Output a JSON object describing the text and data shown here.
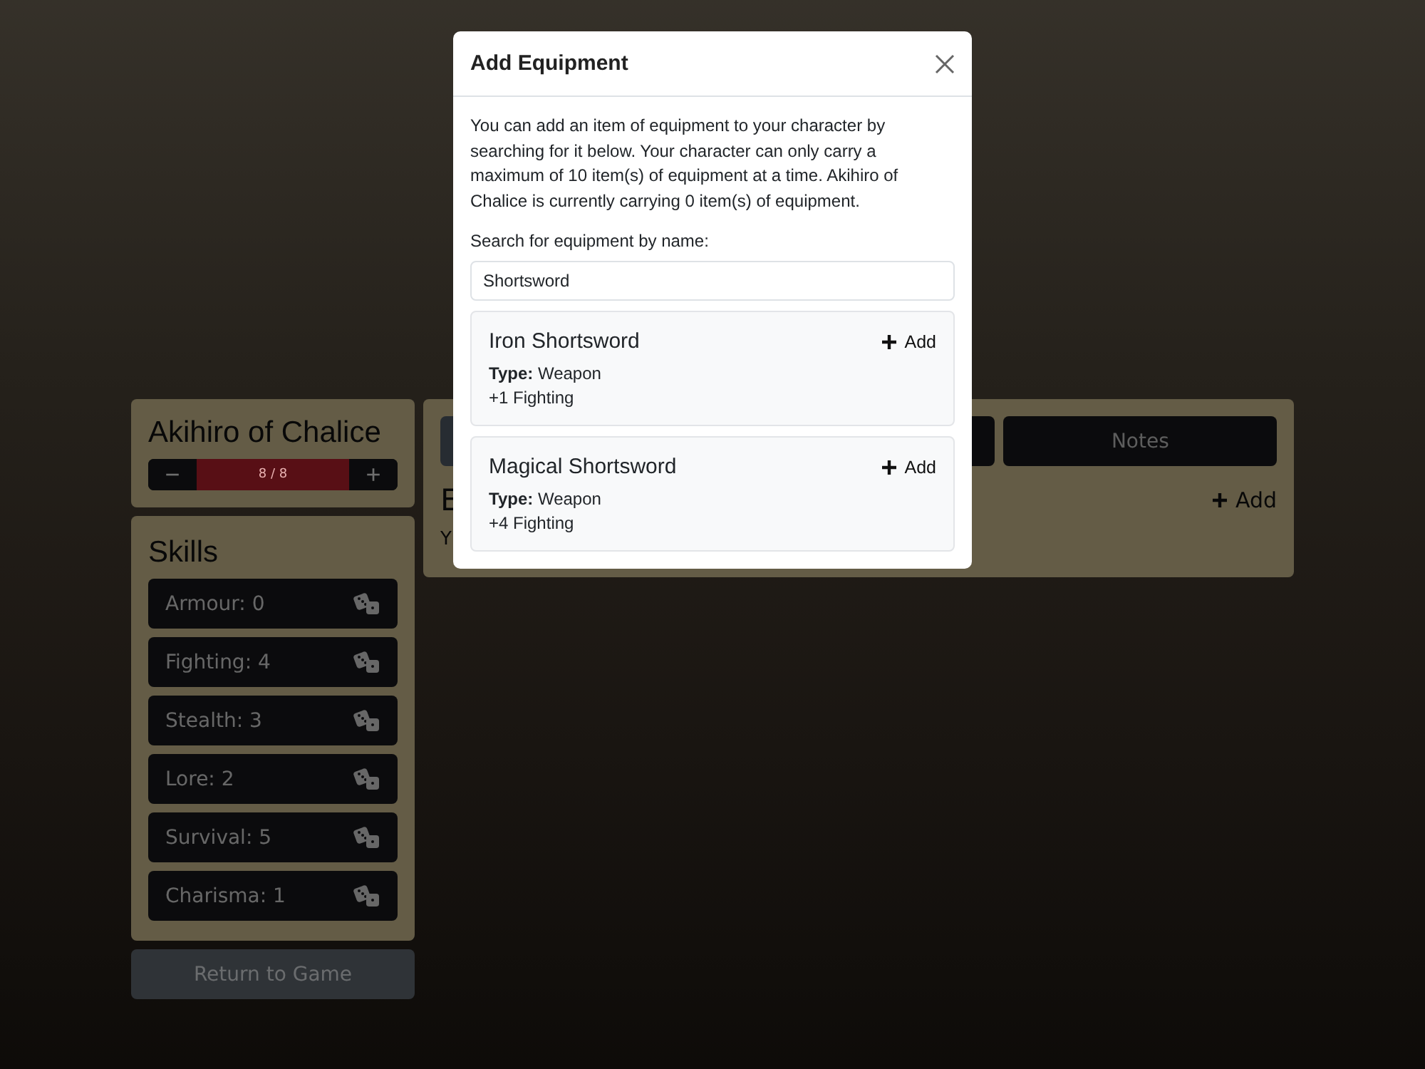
{
  "character": {
    "name": "Akihiro of Chalice",
    "health": {
      "reading": "8 / 8",
      "level": 1,
      "decrease": "−",
      "increase": "+"
    }
  },
  "skills": {
    "title": "Skills",
    "items": [
      {
        "label": "Armour: 0"
      },
      {
        "label": "Fighting: 4"
      },
      {
        "label": "Stealth: 3"
      },
      {
        "label": "Lore: 2"
      },
      {
        "label": "Survival: 5"
      },
      {
        "label": "Charisma: 1"
      }
    ]
  },
  "return_button": "Return to Game",
  "main_panel": {
    "tabs": [
      {
        "selected": true
      },
      {
        "selected": false
      },
      {
        "label": "Notes",
        "selected": false
      }
    ],
    "heading": "E",
    "add_button": "Add",
    "text": "Y"
  },
  "modal": {
    "title": "Add Equipment",
    "intro": "You can add an item of equipment to your character by searching for it below. Your character can only carry a maximum of 10 item(s) of equipment at a time. Akihiro of Chalice is currently carrying 0 item(s) of equipment.",
    "search_label": "Search for equipment by name:",
    "search_value": "Shortsword",
    "results": [
      {
        "name": "Iron Shortsword",
        "add": "Add",
        "type_label": "Type:",
        "type": "Weapon",
        "effect": "+1 Fighting"
      },
      {
        "name": "Magical Shortsword",
        "add": "Add",
        "type_label": "Type:",
        "type": "Weapon",
        "effect": "+4 Fighting"
      }
    ]
  }
}
